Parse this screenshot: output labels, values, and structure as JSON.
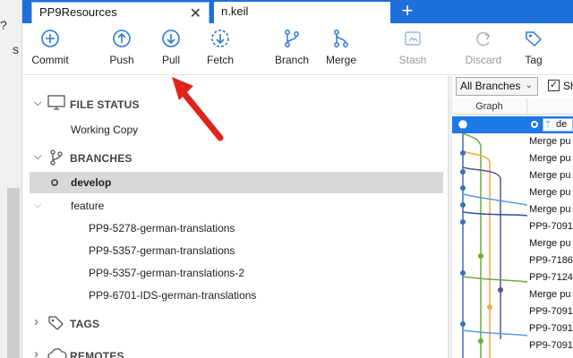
{
  "left_window": {
    "glyph_question": "?",
    "glyph_s": "s"
  },
  "tabs": {
    "active_title": "PP9Resources",
    "inactive_title": "n.keil",
    "close_glyph": "✕",
    "new_tab_glyph": "+"
  },
  "toolbar": {
    "commit": "Commit",
    "push": "Push",
    "pull": "Pull",
    "fetch": "Fetch",
    "branch": "Branch",
    "merge": "Merge",
    "stash": "Stash",
    "discard": "Discard",
    "tag": "Tag"
  },
  "sidebar": {
    "file_status": "FILE STATUS",
    "working_copy": "Working Copy",
    "branches": "BRANCHES",
    "current_branch": "develop",
    "feature_folder": "feature",
    "feature_branches": [
      "PP9-5278-german-translations",
      "PP9-5357-german-translations",
      "PP9-5357-german-translations-2",
      "PP9-6701-IDS-german-translations"
    ],
    "tags": "TAGS",
    "remotes": "REMOTES",
    "chevron_down": "⌵",
    "chevron_right": "›"
  },
  "history": {
    "branch_filter": "All Branches",
    "show_label": "Sh",
    "graph_header": "Graph",
    "selected_tag": "de",
    "commits": [
      "Merge pu",
      "Merge pu",
      "Merge pu",
      "Merge pu",
      "Merge pu",
      "PP9-7091",
      "Merge pu",
      "PP9-7186",
      "PP9-7124",
      "Merge pu",
      "PP9-7091",
      "PP9-7091",
      "PP9-7091"
    ]
  },
  "colors": {
    "tab_bar": "#1e6fd9",
    "accent": "#1e78e6",
    "icon_blue": "#2a7ad4",
    "annotation_arrow": "#e0241b",
    "current_row": "#d8d8d8"
  }
}
